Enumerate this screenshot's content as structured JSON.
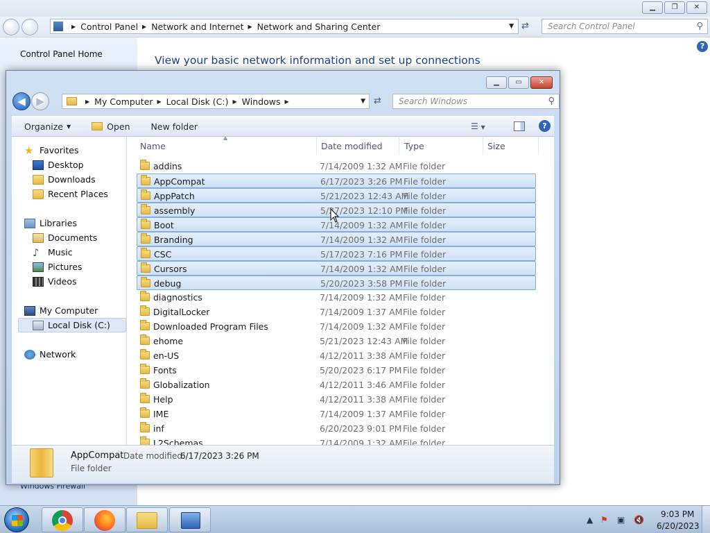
{
  "control_panel": {
    "breadcrumb": [
      "Control Panel",
      "Network and Internet",
      "Network and Sharing Center"
    ],
    "search_placeholder": "Search Control Panel",
    "left_link_home": "Control Panel Home",
    "left_link_bottom": "Windows Firewall",
    "heading": "View your basic network information and set up connections",
    "help_label": "?"
  },
  "explorer": {
    "breadcrumb": [
      "My Computer",
      "Local Disk (C:)",
      "Windows"
    ],
    "search_placeholder": "Search Windows",
    "toolbar": {
      "organize": "Organize",
      "open": "Open",
      "new_folder": "New folder"
    },
    "nav_tree": [
      {
        "label": "Favorites",
        "icon": "star-icon",
        "level": 0
      },
      {
        "label": "Desktop",
        "icon": "desktop-icon",
        "level": 1
      },
      {
        "label": "Downloads",
        "icon": "downloads-icon",
        "level": 1
      },
      {
        "label": "Recent Places",
        "icon": "recent-places-icon",
        "level": 1
      },
      {
        "label": "Libraries",
        "icon": "libraries-icon",
        "level": 0
      },
      {
        "label": "Documents",
        "icon": "documents-icon",
        "level": 1
      },
      {
        "label": "Music",
        "icon": "music-icon",
        "level": 1
      },
      {
        "label": "Pictures",
        "icon": "pictures-icon",
        "level": 1
      },
      {
        "label": "Videos",
        "icon": "videos-icon",
        "level": 1
      },
      {
        "label": "My Computer",
        "icon": "computer-icon",
        "level": 0
      },
      {
        "label": "Local Disk (C:)",
        "icon": "drive-icon",
        "level": 1,
        "selected": true
      },
      {
        "label": "Network",
        "icon": "network-icon",
        "level": 0
      }
    ],
    "columns": [
      "Name",
      "Date modified",
      "Type",
      "Size"
    ],
    "files": [
      {
        "name": "addins",
        "date": "7/14/2009 1:32 AM",
        "type": "File folder",
        "selected": false
      },
      {
        "name": "AppCompat",
        "date": "6/17/2023 3:26 PM",
        "type": "File folder",
        "selected": true
      },
      {
        "name": "AppPatch",
        "date": "5/21/2023 12:43 AM",
        "type": "File folder",
        "selected": true
      },
      {
        "name": "assembly",
        "date": "5/27/2023 12:10 PM",
        "type": "File folder",
        "selected": true
      },
      {
        "name": "Boot",
        "date": "7/14/2009 1:32 AM",
        "type": "File folder",
        "selected": true
      },
      {
        "name": "Branding",
        "date": "7/14/2009 1:32 AM",
        "type": "File folder",
        "selected": true
      },
      {
        "name": "CSC",
        "date": "5/17/2023 7:16 PM",
        "type": "File folder",
        "selected": true
      },
      {
        "name": "Cursors",
        "date": "7/14/2009 1:32 AM",
        "type": "File folder",
        "selected": true
      },
      {
        "name": "debug",
        "date": "5/20/2023 3:58 PM",
        "type": "File folder",
        "selected": true
      },
      {
        "name": "diagnostics",
        "date": "7/14/2009 1:32 AM",
        "type": "File folder",
        "selected": false
      },
      {
        "name": "DigitalLocker",
        "date": "7/14/2009 1:37 AM",
        "type": "File folder",
        "selected": false
      },
      {
        "name": "Downloaded Program Files",
        "date": "7/14/2009 1:32 AM",
        "type": "File folder",
        "selected": false
      },
      {
        "name": "ehome",
        "date": "5/21/2023 12:43 AM",
        "type": "File folder",
        "selected": false
      },
      {
        "name": "en-US",
        "date": "4/12/2011 3:38 AM",
        "type": "File folder",
        "selected": false
      },
      {
        "name": "Fonts",
        "date": "5/20/2023 6:17 PM",
        "type": "File folder",
        "selected": false
      },
      {
        "name": "Globalization",
        "date": "4/12/2011 3:46 AM",
        "type": "File folder",
        "selected": false
      },
      {
        "name": "Help",
        "date": "4/12/2011 3:38 AM",
        "type": "File folder",
        "selected": false
      },
      {
        "name": "IME",
        "date": "7/14/2009 1:37 AM",
        "type": "File folder",
        "selected": false
      },
      {
        "name": "inf",
        "date": "6/20/2023 9:01 PM",
        "type": "File folder",
        "selected": false
      },
      {
        "name": "L2Schemas",
        "date": "7/14/2009 1:32 AM",
        "type": "File folder",
        "selected": false
      }
    ],
    "details": {
      "name": "AppCompat",
      "date_label": "Date modified:",
      "date_value": "6/17/2023 3:26 PM",
      "type": "File folder"
    }
  },
  "taskbar": {
    "apps": [
      "start-orb",
      "chrome-icon",
      "firefox-icon",
      "explorer-icon",
      "control-panel-icon"
    ],
    "clock_time": "9:03 PM",
    "clock_date": "6/20/2023"
  }
}
